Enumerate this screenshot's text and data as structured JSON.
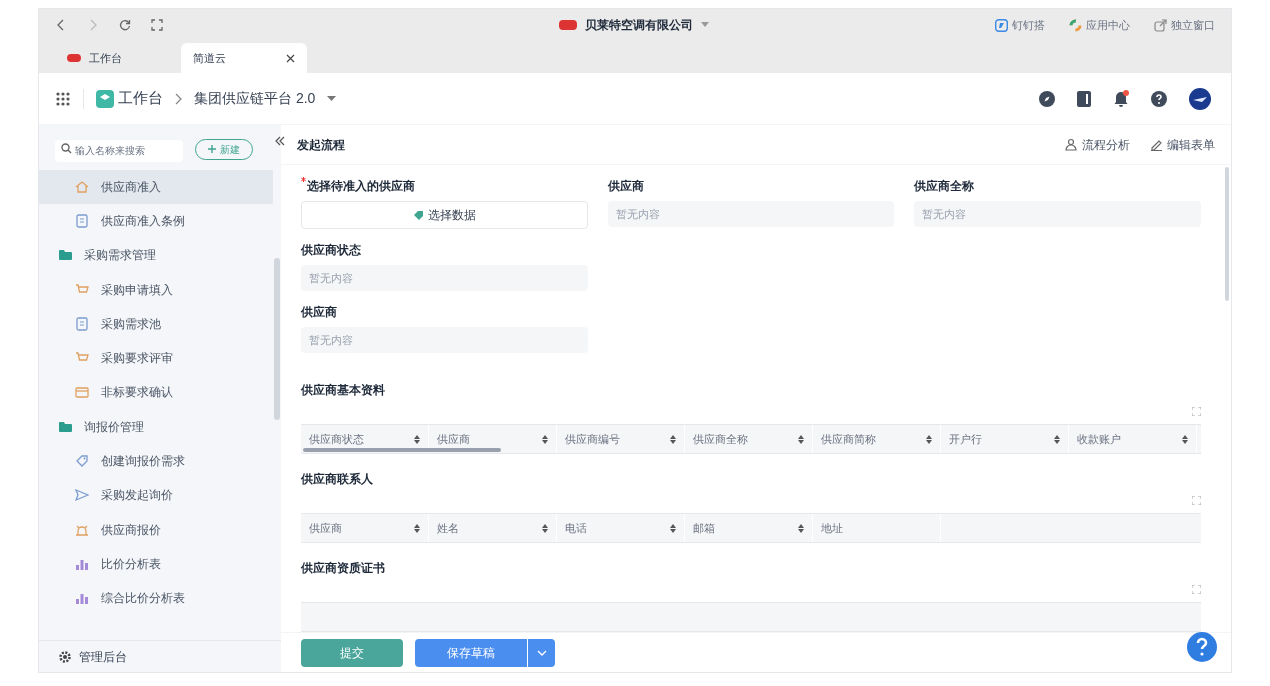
{
  "browser": {
    "org": "贝莱特空调有限公司",
    "links": [
      "钉钉搭",
      "应用中心",
      "独立窗口"
    ],
    "tabs": [
      {
        "label": "工作台",
        "selected": false,
        "closable": false
      },
      {
        "label": "简道云",
        "selected": true,
        "closable": true
      }
    ]
  },
  "app_header": {
    "home": "工作台",
    "app": "集团供应链平台 2.0",
    "notification_dot": true
  },
  "sidebar": {
    "search_placeholder": "输入名称来搜索",
    "new_button": "新建",
    "items": [
      {
        "kind": "item",
        "label": "供应商准入",
        "selected": true
      },
      {
        "kind": "item",
        "label": "供应商准入条例",
        "selected": false
      },
      {
        "kind": "group",
        "label": "采购需求管理",
        "selected": false
      },
      {
        "kind": "item",
        "label": "采购申请填入",
        "selected": false
      },
      {
        "kind": "item",
        "label": "采购需求池",
        "selected": false
      },
      {
        "kind": "item",
        "label": "采购要求评审",
        "selected": false
      },
      {
        "kind": "item",
        "label": "非标要求确认",
        "selected": false
      },
      {
        "kind": "group",
        "label": "询报价管理",
        "selected": false
      },
      {
        "kind": "item",
        "label": "创建询报价需求",
        "selected": false
      },
      {
        "kind": "item",
        "label": "采购发起询价",
        "selected": false
      },
      {
        "kind": "item",
        "label": "供应商报价",
        "selected": false
      },
      {
        "kind": "item",
        "label": "比价分析表",
        "selected": false
      },
      {
        "kind": "item",
        "label": "综合比价分析表",
        "selected": false
      }
    ],
    "footer": "管理后台"
  },
  "form": {
    "title": "发起流程",
    "actions": [
      "流程分析",
      "编辑表单"
    ],
    "field_rows": [
      [
        {
          "kind": "picker",
          "label": "选择待准入的供应商",
          "required": true,
          "value": "选择数据"
        },
        {
          "kind": "readonly",
          "label": "供应商",
          "required": false,
          "placeholder": "暂无内容"
        },
        {
          "kind": "readonly",
          "label": "供应商全称",
          "required": false,
          "placeholder": "暂无内容"
        }
      ],
      [
        {
          "kind": "readonly",
          "label": "供应商状态",
          "required": false,
          "placeholder": "暂无内容"
        }
      ],
      [
        {
          "kind": "readonly",
          "label": "供应商",
          "required": false,
          "placeholder": "暂无内容"
        }
      ]
    ],
    "tables": [
      {
        "title": "供应商基本资料",
        "scrollbar": true,
        "columns": [
          {
            "label": "供应商状态",
            "sortable": true
          },
          {
            "label": "供应商",
            "sortable": true
          },
          {
            "label": "供应商编号",
            "sortable": true
          },
          {
            "label": "供应商全称",
            "sortable": true
          },
          {
            "label": "供应商简称",
            "sortable": true
          },
          {
            "label": "开户行",
            "sortable": true
          },
          {
            "label": "收款账户",
            "sortable": true
          }
        ]
      },
      {
        "title": "供应商联系人",
        "scrollbar": false,
        "columns": [
          {
            "label": "供应商",
            "sortable": true
          },
          {
            "label": "姓名",
            "sortable": true
          },
          {
            "label": "电话",
            "sortable": true
          },
          {
            "label": "邮箱",
            "sortable": true
          },
          {
            "label": "地址",
            "sortable": false
          }
        ]
      },
      {
        "title": "供应商资质证书",
        "scrollbar": false
      }
    ],
    "submit": "提交",
    "save_draft": "保存草稿"
  }
}
